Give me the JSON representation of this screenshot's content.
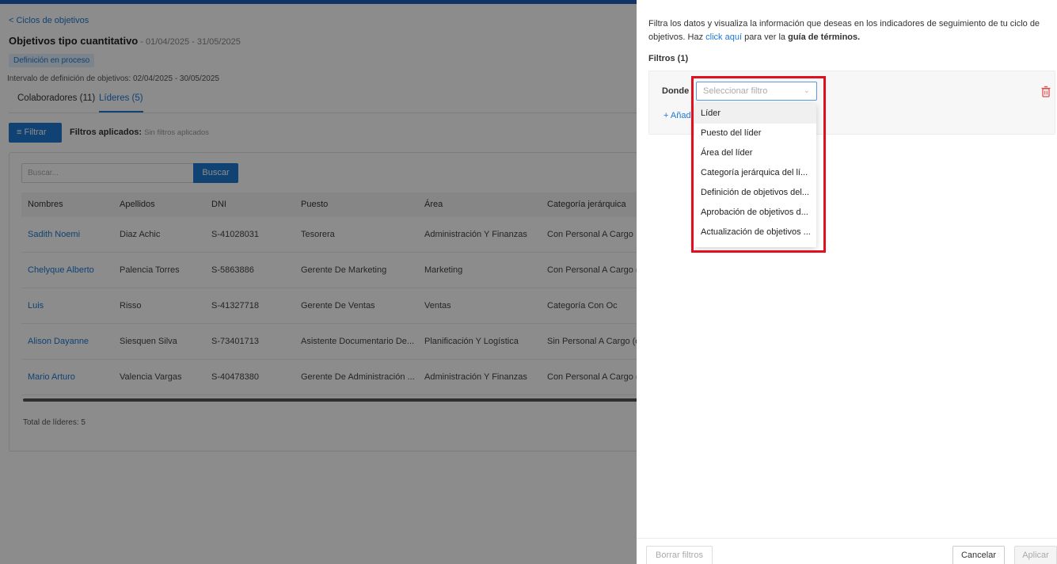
{
  "background": {
    "back_link": "< Ciclos de objetivos",
    "title": "Objetivos tipo cuantitativo",
    "title_dates": " - 01/04/2025 - 31/05/2025",
    "status_badge": "Definición en proceso",
    "interval": "Intervalo de definición de objetivos: 02/04/2025 - 30/05/2025",
    "tabs": [
      {
        "label": "Colaboradores (11)",
        "active": false
      },
      {
        "label": "Líderes (5)",
        "active": true
      }
    ],
    "filter_button": "Filtrar",
    "filters_applied_label": "Filtros aplicados:",
    "filters_applied_value": "Sin filtros aplicados",
    "search_placeholder": "Buscar...",
    "search_button": "Buscar",
    "table": {
      "headers": [
        "Nombres",
        "Apellidos",
        "DNI",
        "Puesto",
        "Área",
        "Categoría jerárquica"
      ],
      "rows": [
        [
          "Sadith Noemi",
          "Diaz Achic",
          "S-41028031",
          "Tesorera",
          "Administración Y Finanzas",
          "Con Personal A Cargo"
        ],
        [
          "Chelyque Alberto",
          "Palencia Torres",
          "S-5863886",
          "Gerente De Marketing",
          "Marketing",
          "Con Personal A Cargo (c"
        ],
        [
          "Luis",
          "Risso",
          "S-41327718",
          "Gerente De Ventas",
          "Ventas",
          "Categoría Con Oc"
        ],
        [
          "Alison Dayanne",
          "Siesquen Silva",
          "S-73401713",
          "Asistente Documentario De...",
          "Planificación Y Logística",
          "Sin Personal A Cargo (co"
        ],
        [
          "Mario Arturo",
          "Valencia Vargas",
          "S-40478380",
          "Gerente De Administración ...",
          "Administración Y Finanzas",
          "Con Personal A Cargo (c"
        ]
      ]
    },
    "total": "Total de líderes: 5"
  },
  "panel": {
    "description_pre": "Filtra los datos y visualiza la información que deseas en los indicadores de seguimiento de tu ciclo de objetivos. Haz ",
    "description_link": "click aquí",
    "description_mid": " para ver la ",
    "description_bold": "guía de términos.",
    "filters_count": "Filtros (1)",
    "donde_label": "Donde",
    "select_placeholder": "Seleccionar filtro",
    "add_filter": "+ Añad",
    "dropdown_options": [
      "Líder",
      "Puesto del líder",
      "Área del líder",
      "Categoría jerárquica del lí...",
      "Definición de objetivos del...",
      "Aprobación de objetivos d...",
      "Actualización de objetivos ..."
    ],
    "footer": {
      "clear": "Borrar filtros",
      "cancel": "Cancelar",
      "apply": "Aplicar"
    }
  },
  "colors": {
    "accent": "#1e78d4",
    "highlight": "#e0101e",
    "danger_icon": "#e34b4b"
  }
}
